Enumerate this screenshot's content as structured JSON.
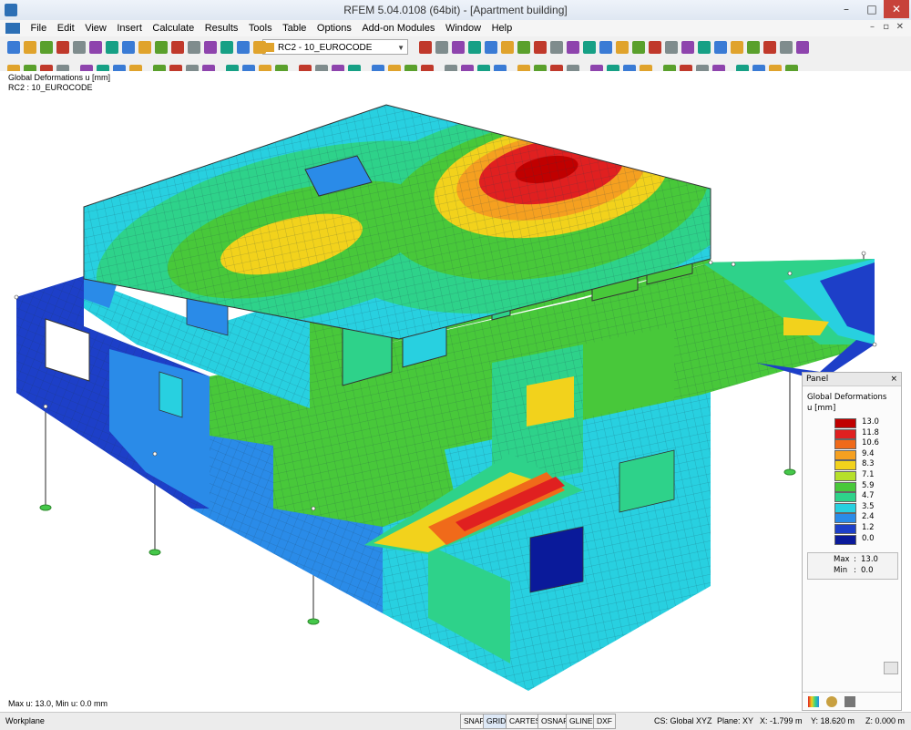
{
  "window": {
    "title": "RFEM 5.04.0108 (64bit) - [Apartment building]"
  },
  "menu": [
    "File",
    "Edit",
    "View",
    "Insert",
    "Calculate",
    "Results",
    "Tools",
    "Table",
    "Options",
    "Add-on Modules",
    "Window",
    "Help"
  ],
  "toolbar": {
    "load_combo": "RC2 - 10_EUROCODE"
  },
  "viewport": {
    "result_title": "Global Deformations u [mm]",
    "result_case": "RC2 : 10_EUROCODE",
    "minmax_text": "Max u: 13.0, Min u: 0.0 mm"
  },
  "panel": {
    "title": "Panel",
    "close": "×",
    "result_label": "Global Deformations",
    "unit": "u [mm]",
    "legend": [
      {
        "value": "13.0",
        "color": "#c00000"
      },
      {
        "value": "11.8",
        "color": "#e02020"
      },
      {
        "value": "10.6",
        "color": "#f06a1a"
      },
      {
        "value": "9.4",
        "color": "#f5a020"
      },
      {
        "value": "8.3",
        "color": "#f2d21c"
      },
      {
        "value": "7.1",
        "color": "#b6e02a"
      },
      {
        "value": "5.9",
        "color": "#48c83a"
      },
      {
        "value": "4.7",
        "color": "#2ed28a"
      },
      {
        "value": "3.5",
        "color": "#28d0e0"
      },
      {
        "value": "2.4",
        "color": "#2a8be8"
      },
      {
        "value": "1.2",
        "color": "#1d3fc8"
      },
      {
        "value": "0.0",
        "color": "#0a1a9a"
      }
    ],
    "max_label": "Max",
    "max_value": "13.0",
    "min_label": "Min",
    "min_value": "0.0",
    "colon": ":"
  },
  "status": {
    "workplane": "Workplane",
    "toggles": [
      "SNAP",
      "GRID",
      "CARTES",
      "OSNAP",
      "GLINES",
      "DXF"
    ],
    "cs": "CS: Global XYZ",
    "plane": "Plane: XY",
    "x": "X: -1.799 m",
    "y": "Y: 18.620 m",
    "z": "Z: 0.000 m"
  },
  "colors": {
    "deep_blue": "#1d3fc8",
    "blue": "#2a8be8",
    "cyan": "#28d0e0",
    "green": "#2ed28a",
    "lime": "#48c83a",
    "yellow": "#f2d21c",
    "orange": "#f5a020",
    "red": "#e02020"
  }
}
